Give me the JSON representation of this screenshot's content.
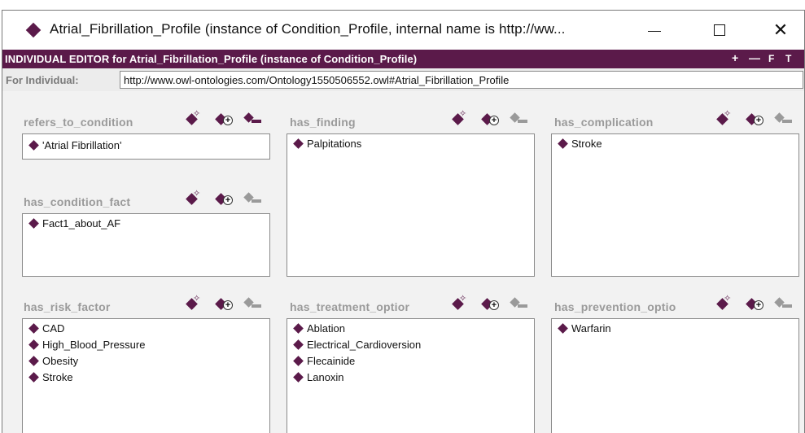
{
  "window": {
    "title": "Atrial_Fibrillation_Profile   (instance of Condition_Profile, internal name is http://ww...",
    "minimize_label": "—",
    "maximize_label": "☐",
    "close_label": "✕"
  },
  "editor": {
    "header_title": "INDIVIDUAL EDITOR for Atrial_Fibrillation_Profile   (instance of Condition_Profile)",
    "header_buttons": [
      "+",
      "—",
      "F",
      "T"
    ],
    "for_individual_label": "For Individual:",
    "for_individual_value": "http://www.owl-ontologies.com/Ontology1550506552.owl#Atrial_Fibrillation_Profile"
  },
  "slots": {
    "refers_to_condition": {
      "label": "refers_to_condition",
      "items": [
        "'Atrial Fibrillation'"
      ]
    },
    "has_condition_fact": {
      "label": "has_condition_fact",
      "items": [
        "Fact1_about_AF"
      ]
    },
    "has_finding": {
      "label": "has_finding",
      "items": [
        "Palpitations"
      ]
    },
    "has_complication": {
      "label": "has_complication",
      "items": [
        "Stroke"
      ]
    },
    "has_risk_factor": {
      "label": "has_risk_factor",
      "items": [
        "CAD",
        "High_Blood_Pressure",
        "Obesity",
        "Stroke"
      ]
    },
    "has_treatment_option": {
      "label": "has_treatment_optior",
      "items": [
        "Ablation",
        "Electrical_Cardioversion",
        "Flecainide",
        "Lanoxin"
      ]
    },
    "has_prevention_option": {
      "label": "has_prevention_optio",
      "items": [
        "Warfarin"
      ]
    }
  },
  "icons": {
    "window_icon": "diamond-icon",
    "create_instance": "create-instance-icon",
    "add_instance": "add-instance-icon",
    "remove_instance": "remove-instance-icon"
  },
  "colors": {
    "accent": "#5b1a4a",
    "slot_label": "#9a9a9a",
    "disabled_icon": "#9a9a9a"
  }
}
